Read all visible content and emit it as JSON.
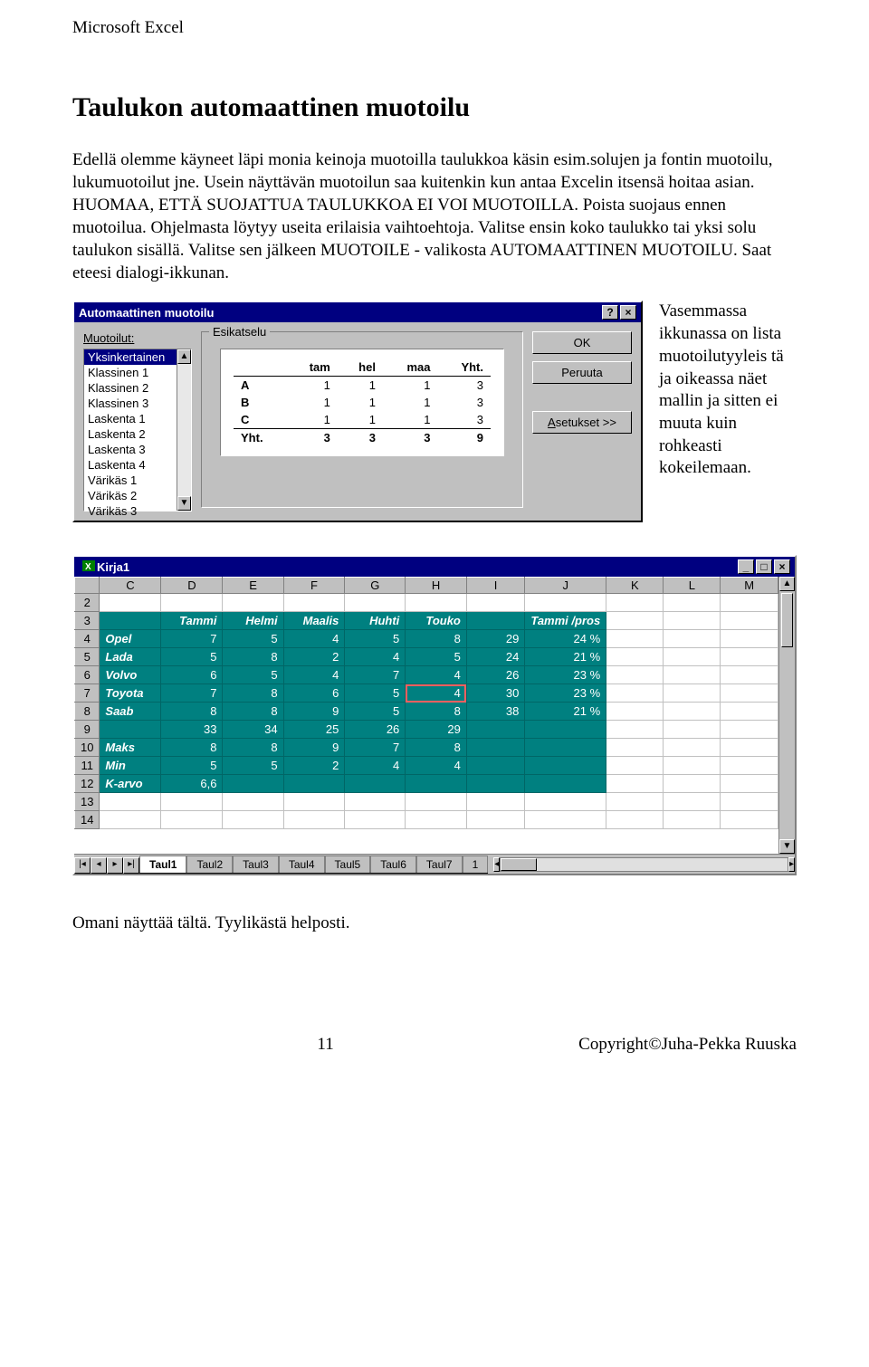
{
  "header_app": "Microsoft Excel",
  "title": "Taulukon automaattinen muotoilu",
  "para1": "Edellä olemme käyneet läpi monia keinoja muotoilla taulukkoa käsin esim.solujen ja fontin muotoilu, lukumuotoilut jne. Usein näyttävän muotoilun saa kuitenkin kun antaa Excelin itsensä hoitaa asian. HUOMAA, ETTÄ SUOJATTUA TAULUKKOA EI VOI MUOTOILLA. Poista suojaus ennen muotoilua. Ohjelmasta löytyy useita erilaisia vaihtoehtoja. Valitse ensin koko taulukko tai yksi solu taulukon sisällä. Valitse sen jälkeen MUOTOILE - valikosta AUTOMAATTINEN MUOTOILU. Saat eteesi dialogi-ikkunan.",
  "side_text": "Vasemmassa ikkunassa on lista muotoilutyyleis tä ja oikeassa näet mallin ja sitten ei muuta kuin rohkeasti kokeilemaan.",
  "dialog": {
    "title": "Automaattinen muotoilu",
    "list_label": "Muotoilut:",
    "items": [
      "Yksinkertainen",
      "Klassinen 1",
      "Klassinen 2",
      "Klassinen 3",
      "Laskenta 1",
      "Laskenta 2",
      "Laskenta 3",
      "Laskenta 4",
      "Värikäs 1",
      "Värikäs 2",
      "Värikäs 3"
    ],
    "preview_label": "Esikatselu",
    "buttons": {
      "ok": "OK",
      "cancel": "Peruuta",
      "options": "Asetukset >>"
    },
    "chart_data": {
      "type": "table",
      "columns": [
        "",
        "tam",
        "hel",
        "maa",
        "Yht."
      ],
      "rows": [
        [
          "A",
          1,
          1,
          1,
          3
        ],
        [
          "B",
          1,
          1,
          1,
          3
        ],
        [
          "C",
          1,
          1,
          1,
          3
        ],
        [
          "Yht.",
          3,
          3,
          3,
          9
        ]
      ]
    }
  },
  "workbook": {
    "title": "Kirja1",
    "cols": [
      "C",
      "D",
      "E",
      "F",
      "G",
      "H",
      "I",
      "J",
      "K",
      "L",
      "M"
    ],
    "rows": [
      {
        "n": "2",
        "cells": [
          "",
          "",
          "",
          "",
          "",
          "",
          "",
          "",
          "",
          "",
          ""
        ],
        "teal": false
      },
      {
        "n": "3",
        "cells": [
          "",
          "Tammi",
          "Helmi",
          "Maalis",
          "Huhti",
          "Touko",
          "",
          "Tammi /pros",
          "",
          "",
          ""
        ],
        "hdr": true
      },
      {
        "n": "4",
        "cells": [
          "Opel",
          "7",
          "5",
          "4",
          "5",
          "8",
          "29",
          "24 %",
          "",
          "",
          ""
        ]
      },
      {
        "n": "5",
        "cells": [
          "Lada",
          "5",
          "8",
          "2",
          "4",
          "5",
          "24",
          "21 %",
          "",
          "",
          ""
        ]
      },
      {
        "n": "6",
        "cells": [
          "Volvo",
          "6",
          "5",
          "4",
          "7",
          "4",
          "26",
          "23 %",
          "",
          "",
          ""
        ]
      },
      {
        "n": "7",
        "cells": [
          "Toyota",
          "7",
          "8",
          "6",
          "5",
          "4",
          "30",
          "23 %",
          "",
          "",
          ""
        ],
        "cursor": 5
      },
      {
        "n": "8",
        "cells": [
          "Saab",
          "8",
          "8",
          "9",
          "5",
          "8",
          "38",
          "21 %",
          "",
          "",
          ""
        ]
      },
      {
        "n": "9",
        "cells": [
          "",
          "33",
          "34",
          "25",
          "26",
          "29",
          "",
          "",
          "",
          "",
          ""
        ]
      },
      {
        "n": "10",
        "cells": [
          "Maks",
          "8",
          "8",
          "9",
          "7",
          "8",
          "",
          "",
          "",
          "",
          ""
        ]
      },
      {
        "n": "11",
        "cells": [
          "Min",
          "5",
          "5",
          "2",
          "4",
          "4",
          "",
          "",
          "",
          "",
          ""
        ]
      },
      {
        "n": "12",
        "cells": [
          "K-arvo",
          "6,6",
          "",
          "",
          "",
          "",
          "",
          "",
          "",
          "",
          ""
        ]
      },
      {
        "n": "13",
        "cells": [
          "",
          "",
          "",
          "",
          "",
          "",
          "",
          "",
          "",
          "",
          ""
        ],
        "teal": false
      },
      {
        "n": "14",
        "cells": [
          "",
          "",
          "",
          "",
          "",
          "",
          "",
          "",
          "",
          "",
          ""
        ],
        "teal": false
      }
    ],
    "tabs": [
      "Taul1",
      "Taul2",
      "Taul3",
      "Taul4",
      "Taul5",
      "Taul6",
      "Taul7",
      "1"
    ]
  },
  "closing": "Omani näyttää tältä. Tyylikästä helposti.",
  "footer": {
    "page": "11",
    "copy": "Copyright©Juha-Pekka Ruuska"
  }
}
